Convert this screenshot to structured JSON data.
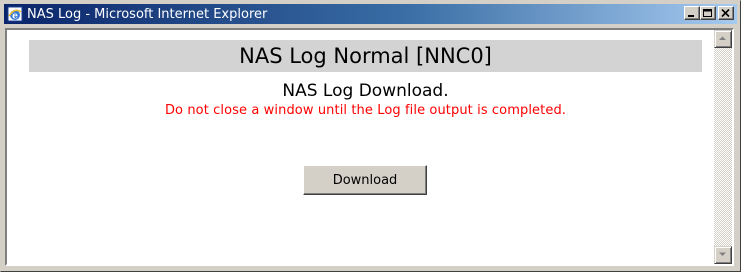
{
  "window": {
    "title": "NAS Log - Microsoft Internet Explorer",
    "icon": "internet-explorer-icon",
    "controls": [
      "minimize-icon",
      "maximize-icon",
      "close-icon"
    ]
  },
  "page": {
    "header": "NAS Log Normal [NNC0]",
    "subtitle": "NAS Log Download.",
    "warning": "Do not close a window until the Log file output is completed.",
    "download_button": "Download"
  },
  "colors": {
    "warning_text": "#ff0000",
    "header_bar": "#d3d3d3",
    "titlebar_start": "#0a246a",
    "titlebar_end": "#a6caf0"
  }
}
